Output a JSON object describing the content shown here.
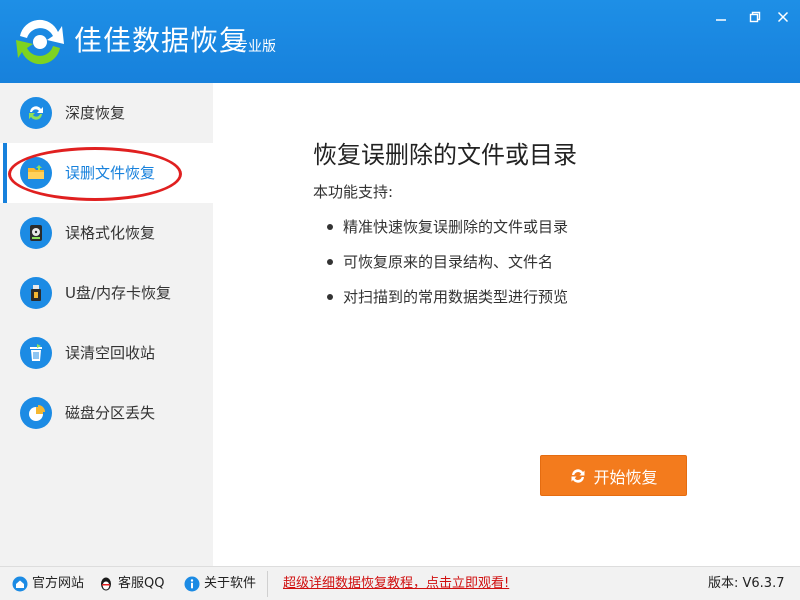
{
  "app": {
    "title": "佳佳数据恢复",
    "edition": "专业版",
    "colors": {
      "primary": "#1781dc",
      "accent": "#f37b1d",
      "annotation": "#e02020",
      "promo": "#d01010"
    }
  },
  "window_controls": [
    {
      "icon": "minimize-icon"
    },
    {
      "icon": "maximize-icon"
    },
    {
      "icon": "close-icon"
    }
  ],
  "sidebar": {
    "items": [
      {
        "label": "深度恢复",
        "icon": "deep-scan-icon",
        "active": false
      },
      {
        "label": "误删文件恢复",
        "icon": "folder-icon",
        "active": true
      },
      {
        "label": "误格式化恢复",
        "icon": "hard-disk-icon",
        "active": false
      },
      {
        "label": "U盘/内存卡恢复",
        "icon": "usb-drive-icon",
        "active": false
      },
      {
        "label": "误清空回收站",
        "icon": "recycle-bin-icon",
        "active": false
      },
      {
        "label": "磁盘分区丢失",
        "icon": "pie-partition-icon",
        "active": false
      }
    ]
  },
  "main": {
    "title": "恢复误删除的文件或目录",
    "subtitle": "本功能支持:",
    "features": [
      "精准快速恢复误删除的文件或目录",
      "可恢复原来的目录结构、文件名",
      "对扫描到的常用数据类型进行预览"
    ],
    "start_button": "开始恢复"
  },
  "footer": {
    "links": [
      {
        "label": "官方网站",
        "icon": "home-icon"
      },
      {
        "label": "客服QQ",
        "icon": "qq-penguin-icon"
      },
      {
        "label": "关于软件",
        "icon": "info-icon"
      }
    ],
    "promo": "超级详细数据恢复教程，点击立即观看!",
    "version": "版本: V6.3.7"
  }
}
